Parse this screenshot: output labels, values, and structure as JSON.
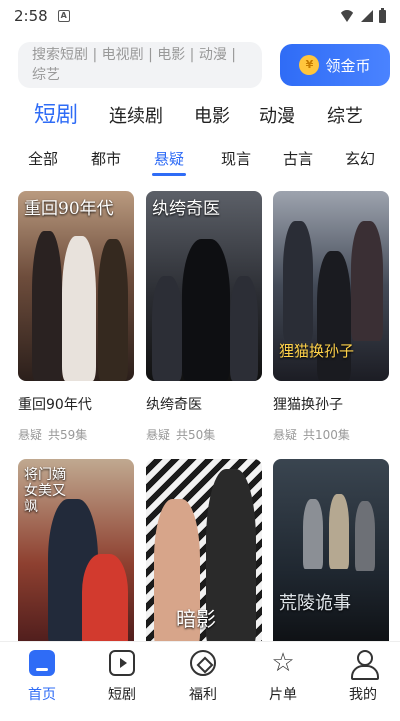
{
  "status": {
    "time": "2:58",
    "app_badge": "A"
  },
  "search": {
    "placeholder": "搜索短剧 | 电视剧 | 电影 | 动漫 | 综艺",
    "coin_label": "领金币",
    "coin_symbol": "¥"
  },
  "main_tabs": [
    {
      "label": "短剧",
      "active": true
    },
    {
      "label": "连续剧",
      "active": false
    },
    {
      "label": "电影",
      "active": false
    },
    {
      "label": "动漫",
      "active": false
    },
    {
      "label": "综艺",
      "active": false
    }
  ],
  "sub_tabs": [
    {
      "label": "全部",
      "active": false
    },
    {
      "label": "都市",
      "active": false
    },
    {
      "label": "悬疑",
      "active": true
    },
    {
      "label": "现言",
      "active": false
    },
    {
      "label": "古言",
      "active": false
    },
    {
      "label": "玄幻",
      "active": false
    }
  ],
  "dramas": [
    {
      "title": "重回90年代",
      "poster_text": "重回90年代",
      "genre": "悬疑",
      "episodes": "共59集"
    },
    {
      "title": "纨绔奇医",
      "poster_text": "纨绔奇医",
      "genre": "悬疑",
      "episodes": "共50集"
    },
    {
      "title": "狸猫换孙子",
      "poster_text": "狸猫换孙子",
      "genre": "悬疑",
      "episodes": "共100集"
    },
    {
      "title": "",
      "poster_text": "将门嫡女美又飒"
    },
    {
      "title": "",
      "poster_text": "暗影"
    },
    {
      "title": "",
      "poster_text": "荒陵诡事"
    }
  ],
  "tabbar": [
    {
      "label": "首页",
      "icon": "home-icon",
      "active": true
    },
    {
      "label": "短剧",
      "icon": "play-icon",
      "active": false
    },
    {
      "label": "福利",
      "icon": "gift-icon",
      "active": false
    },
    {
      "label": "片单",
      "icon": "star-icon",
      "active": false
    },
    {
      "label": "我的",
      "icon": "user-icon",
      "active": false
    }
  ],
  "colors": {
    "accent": "#2f6cf6",
    "coin": "#ffc53d"
  }
}
